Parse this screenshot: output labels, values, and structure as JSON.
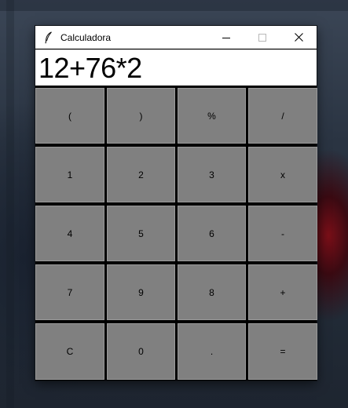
{
  "window": {
    "title": "Calculadora",
    "icon": "feather-icon",
    "controls": [
      "minimize-icon",
      "maximize-icon",
      "close-icon"
    ]
  },
  "display": {
    "expression": "12+76*2"
  },
  "keys": [
    [
      "(",
      ")",
      "%",
      "/"
    ],
    [
      "1",
      "2",
      "3",
      "x"
    ],
    [
      "4",
      "5",
      "6",
      "-"
    ],
    [
      "7",
      "9",
      "8",
      "+"
    ],
    [
      "C",
      "0",
      ".",
      "="
    ]
  ],
  "colors": {
    "key_background": "#808080",
    "grid_background": "#000000",
    "display_background": "#ffffff"
  }
}
